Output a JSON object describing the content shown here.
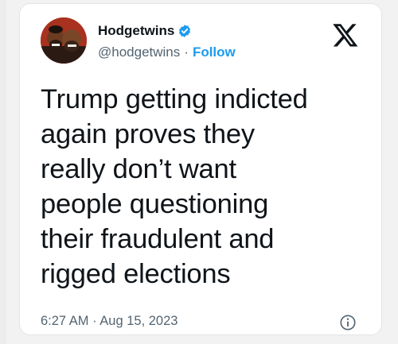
{
  "tweet": {
    "display_name": "Hodgetwins",
    "handle": "@hodgetwins",
    "separator": "·",
    "follow_label": "Follow",
    "text": "Trump getting indicted\nagain proves they\nreally don’t want\npeople questioning\ntheir fraudulent and\nrigged elections",
    "timestamp": "6:27 AM · Aug 15, 2023",
    "verified": true
  },
  "icons": {
    "avatar": "profile-photo",
    "badge": "verified-badge-icon",
    "logo": "x-logo-icon",
    "info": "info-icon"
  },
  "colors": {
    "text": "#0f1419",
    "secondary": "#536471",
    "accent": "#1d9bf0"
  }
}
